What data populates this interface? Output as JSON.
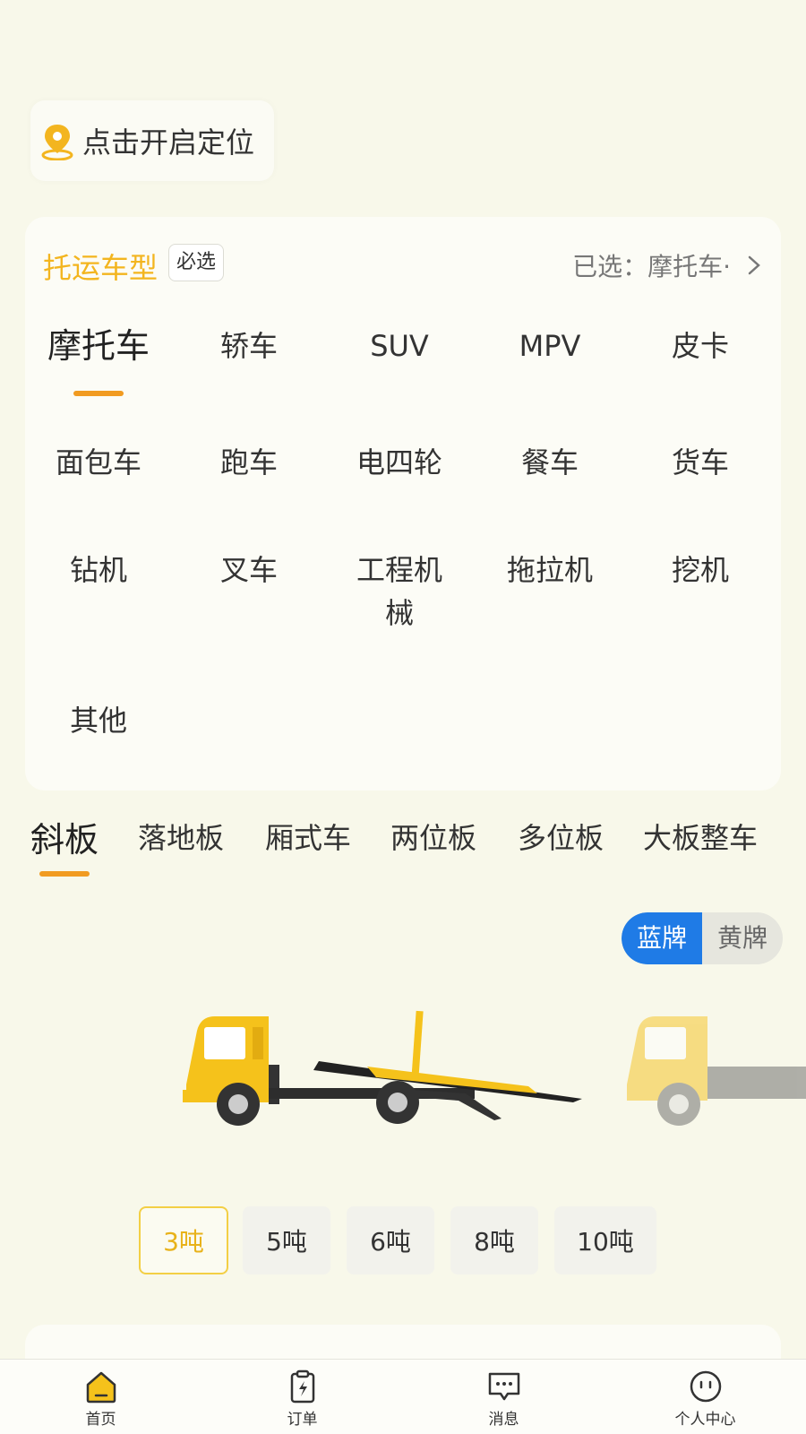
{
  "location": {
    "label": "点击开启定位"
  },
  "vehicle_card": {
    "title": "托运车型",
    "required_tag": "必选",
    "selected": "已选：摩托车·",
    "types": [
      {
        "label": "摩托车",
        "active": true
      },
      {
        "label": "轿车"
      },
      {
        "label": "SUV"
      },
      {
        "label": "MPV"
      },
      {
        "label": "皮卡"
      },
      {
        "label": "面包车"
      },
      {
        "label": "跑车"
      },
      {
        "label": "电四轮"
      },
      {
        "label": "餐车"
      },
      {
        "label": "货车"
      },
      {
        "label": "钻机"
      },
      {
        "label": "叉车"
      },
      {
        "label": "工程机\n械"
      },
      {
        "label": "拖拉机"
      },
      {
        "label": "挖机"
      },
      {
        "label": "其他"
      }
    ]
  },
  "truck_tabs": [
    "斜板",
    "落地板",
    "厢式车",
    "两位板",
    "多位板",
    "大板整车"
  ],
  "plate_toggle": {
    "blue": "蓝牌",
    "yellow": "黄牌"
  },
  "tonnage": [
    "3吨",
    "5吨",
    "6吨",
    "8吨",
    "10吨"
  ],
  "bottom_nav": {
    "home": "首页",
    "orders": "订单",
    "messages": "消息",
    "profile": "个人中心"
  },
  "colors": {
    "accent_yellow": "#f3b51f",
    "accent_orange": "#f19b21",
    "plate_blue": "#1f7be6"
  }
}
